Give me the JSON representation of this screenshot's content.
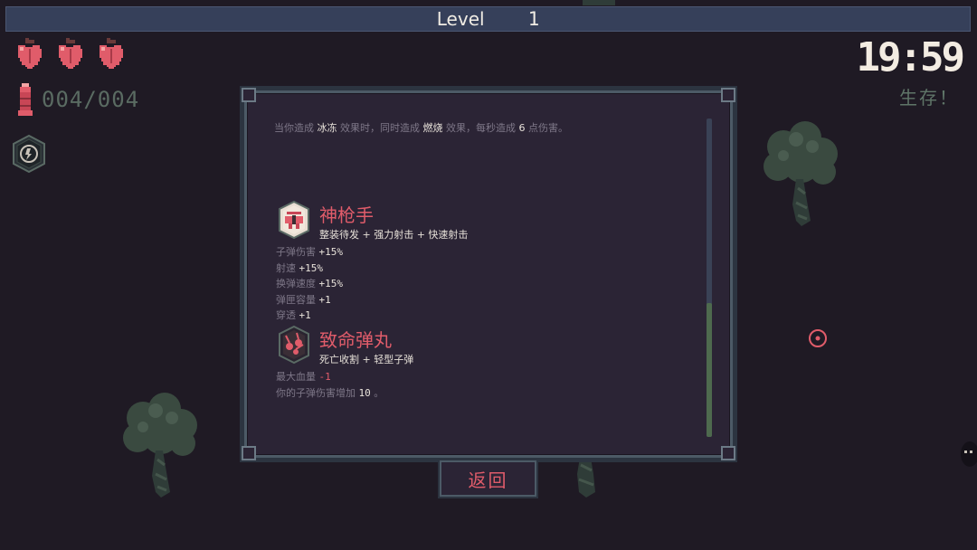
{
  "hud": {
    "level_label": "Level",
    "level_value": "1",
    "hearts": 3,
    "ammo": "004/004",
    "timer": "19:59",
    "objective": "生存！"
  },
  "modal": {
    "intro": {
      "p1": "当你造成",
      "k1": "冰冻",
      "p2": "效果时，同时造成",
      "k2": "燃烧",
      "p3": "效果，每秒造成",
      "k3": "6",
      "p4": "点伤害。"
    },
    "items": [
      {
        "title": "神枪手",
        "combo": "整装待发 + 强力射击 + 快速射击",
        "icon": "marksman-icon",
        "stats": [
          {
            "label": "子弹伤害",
            "value": "+15%"
          },
          {
            "label": "射速",
            "value": "+15%"
          },
          {
            "label": "换弹速度",
            "value": "+15%"
          },
          {
            "label": "弹匣容量",
            "value": "+1"
          },
          {
            "label": "穿透",
            "value": "+1"
          }
        ]
      },
      {
        "title": "致命弹丸",
        "combo": "死亡收割 + 轻型子弹",
        "icon": "deadly-bullets-icon",
        "stats": [
          {
            "label": "最大血量",
            "value": "-1"
          }
        ],
        "desc_prefix": "你的子弹伤害增加",
        "desc_value": "10",
        "desc_suffix": "。"
      }
    ],
    "back_label": "返回"
  },
  "colors": {
    "accent_red": "#e05c6a",
    "background": "#1f1a24",
    "panel": "#2b2435",
    "muted_green": "#5f7568"
  }
}
